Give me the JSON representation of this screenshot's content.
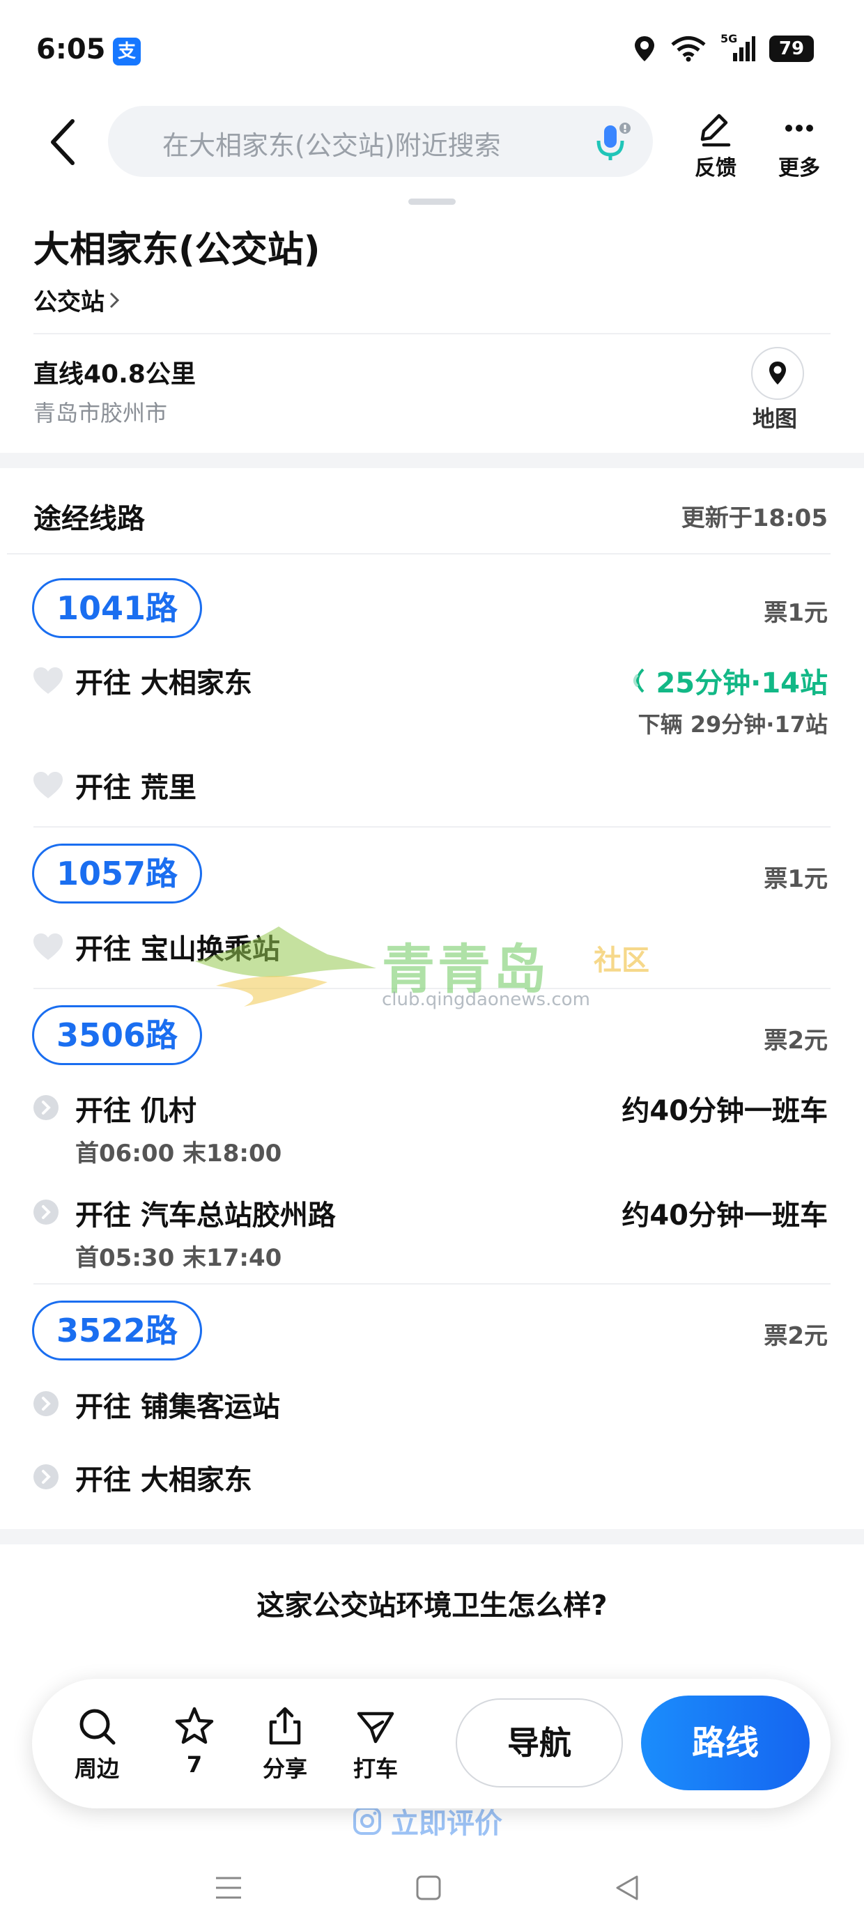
{
  "status_bar": {
    "time": "6:05",
    "app_badge": "支",
    "network": "5G",
    "battery": "79"
  },
  "header": {
    "search_placeholder": "在大相家东(公交站)附近搜索",
    "feedback_label": "反馈",
    "more_label": "更多"
  },
  "station": {
    "name": "大相家东(公交站)",
    "type": "公交站",
    "distance": "直线40.8公里",
    "district": "青岛市胶州市",
    "map_label": "地图"
  },
  "routes_section": {
    "title": "途经线路",
    "updated": "更新于18:05"
  },
  "routes": [
    {
      "name": "1041路",
      "fare": "票1元",
      "directions": [
        {
          "text": "开往  大相家东",
          "realtime": "25分钟·14站",
          "next": "下辆 29分钟·17站"
        },
        {
          "text": "开往  荒里"
        }
      ]
    },
    {
      "name": "1057路",
      "fare": "票1元",
      "directions": [
        {
          "text": "开往  宝山换乘站"
        }
      ]
    },
    {
      "name": "3506路",
      "fare": "票2元",
      "directions": [
        {
          "text": "开往  仉村",
          "freq": "约40分钟一班车",
          "schedule": "首06:00   末18:00"
        },
        {
          "text": "开往  汽车总站胶州路",
          "freq": "约40分钟一班车",
          "schedule": "首05:30   末17:40"
        }
      ]
    },
    {
      "name": "3522路",
      "fare": "票2元",
      "directions": [
        {
          "text": "开往  铺集客运站"
        },
        {
          "text": "开往  大相家东"
        }
      ]
    }
  ],
  "watermark": {
    "main": "青青岛",
    "sub": "社区",
    "url": "club.qingdaonews.com"
  },
  "survey": {
    "question": "这家公交站环境卫生怎么样?",
    "rate_now": "立即评价"
  },
  "bottom_bar": {
    "nearby": "周边",
    "favorites_count": "7",
    "share": "分享",
    "taxi": "打车",
    "navigate": "导航",
    "route": "路线"
  },
  "colors": {
    "accent": "#1a6ef0",
    "realtime_green": "#12b886",
    "muted_text": "#8a8f96"
  }
}
